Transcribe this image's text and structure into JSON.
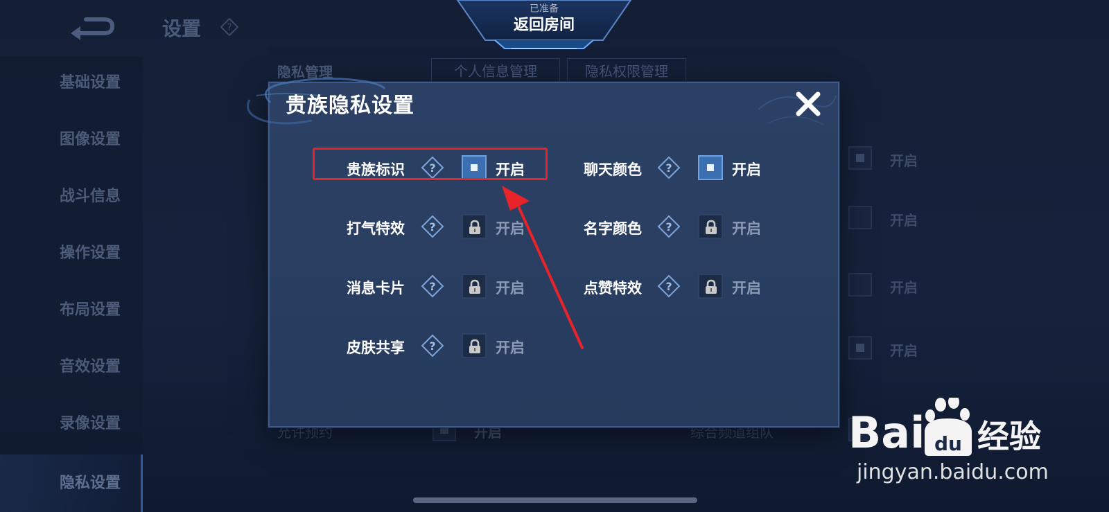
{
  "header": {
    "page_title": "设置",
    "ready_sub": "已准备",
    "ready_main": "返回房间"
  },
  "sidebar": {
    "items": [
      {
        "label": "基础设置"
      },
      {
        "label": "图像设置"
      },
      {
        "label": "战斗信息"
      },
      {
        "label": "操作设置"
      },
      {
        "label": "布局设置"
      },
      {
        "label": "音效设置"
      },
      {
        "label": "录像设置"
      },
      {
        "label": "隐私设置",
        "active": true
      }
    ]
  },
  "background": {
    "section_label": "隐私管理",
    "tabs": [
      {
        "label": "个人信息管理"
      },
      {
        "label": "隐私权限管理"
      }
    ],
    "right_toggles": [
      {
        "state": "开启"
      },
      {
        "state": "开启"
      },
      {
        "state": "开启"
      },
      {
        "state": "开启"
      },
      {
        "state": "开"
      }
    ],
    "bottom_left_label": "允许预约",
    "bottom_left_state": "开启",
    "bottom_right_label": "综合频道组队"
  },
  "modal": {
    "title": "贵族隐私设置",
    "options": [
      {
        "label": "贵族标识",
        "state": "开启",
        "status": "on"
      },
      {
        "label": "聊天颜色",
        "state": "开启",
        "status": "on"
      },
      {
        "label": "打气特效",
        "state": "开启",
        "status": "locked"
      },
      {
        "label": "名字颜色",
        "state": "开启",
        "status": "locked"
      },
      {
        "label": "消息卡片",
        "state": "开启",
        "status": "locked"
      },
      {
        "label": "点赞特效",
        "state": "开启",
        "status": "locked"
      },
      {
        "label": "皮肤共享",
        "state": "开启",
        "status": "locked"
      }
    ]
  },
  "watermark": {
    "logo_text_1": "Bai",
    "logo_text_2": "du",
    "logo_text_3": "经验",
    "url": "jingyan.baidu.com"
  },
  "colors": {
    "annotation_red": "#e8232a",
    "toggle_on": "#3b6fb0",
    "modal_bg": "#2a3f62"
  },
  "icons": [
    "back-arrow-icon",
    "help-icon",
    "close-icon",
    "lock-icon",
    "baidu-paw-icon"
  ]
}
